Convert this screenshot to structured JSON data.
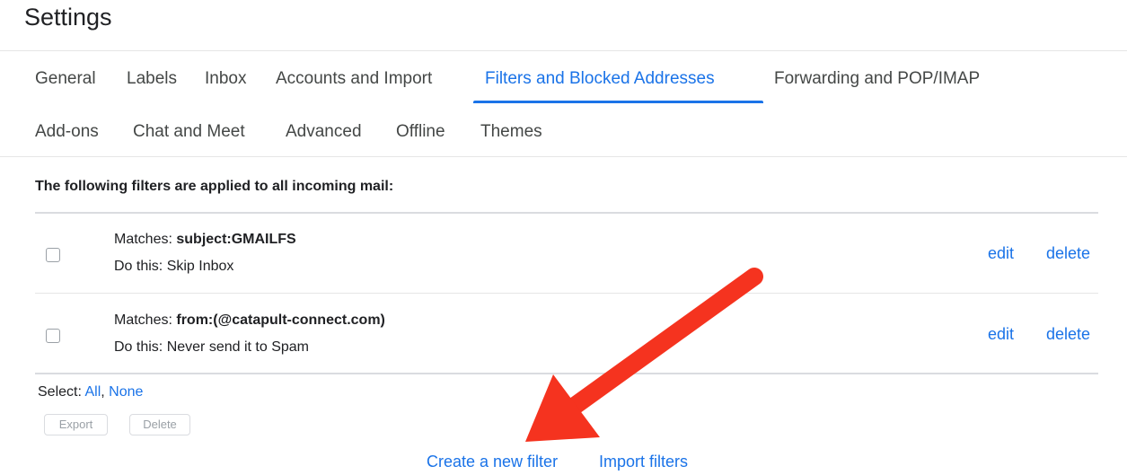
{
  "page": {
    "title": "Settings"
  },
  "tabs_row1": [
    {
      "label": "General"
    },
    {
      "label": "Labels"
    },
    {
      "label": "Inbox"
    },
    {
      "label": "Accounts and Import"
    },
    {
      "label": "Filters and Blocked Addresses",
      "active": true
    },
    {
      "label": "Forwarding and POP/IMAP"
    }
  ],
  "tabs_row2": [
    {
      "label": "Add-ons"
    },
    {
      "label": "Chat and Meet"
    },
    {
      "label": "Advanced"
    },
    {
      "label": "Offline"
    },
    {
      "label": "Themes"
    }
  ],
  "filters": {
    "heading": "The following filters are applied to all incoming mail:",
    "items": [
      {
        "matches_label": "Matches:",
        "matches_value": "subject:GMAILFS",
        "action": "Do this: Skip Inbox",
        "edit_label": "edit",
        "delete_label": "delete"
      },
      {
        "matches_label": "Matches:",
        "matches_value": "from:(@catapult-connect.com)",
        "action": "Do this: Never send it to Spam",
        "edit_label": "edit",
        "delete_label": "delete"
      }
    ]
  },
  "select": {
    "label": "Select:",
    "all": "All",
    "separator": ",",
    "none": "None"
  },
  "buttons": {
    "export": "Export",
    "delete": "Delete"
  },
  "footer": {
    "create": "Create a new filter",
    "import": "Import filters"
  },
  "colors": {
    "accent": "#1a73e8",
    "annotation_arrow": "#f5331f"
  }
}
